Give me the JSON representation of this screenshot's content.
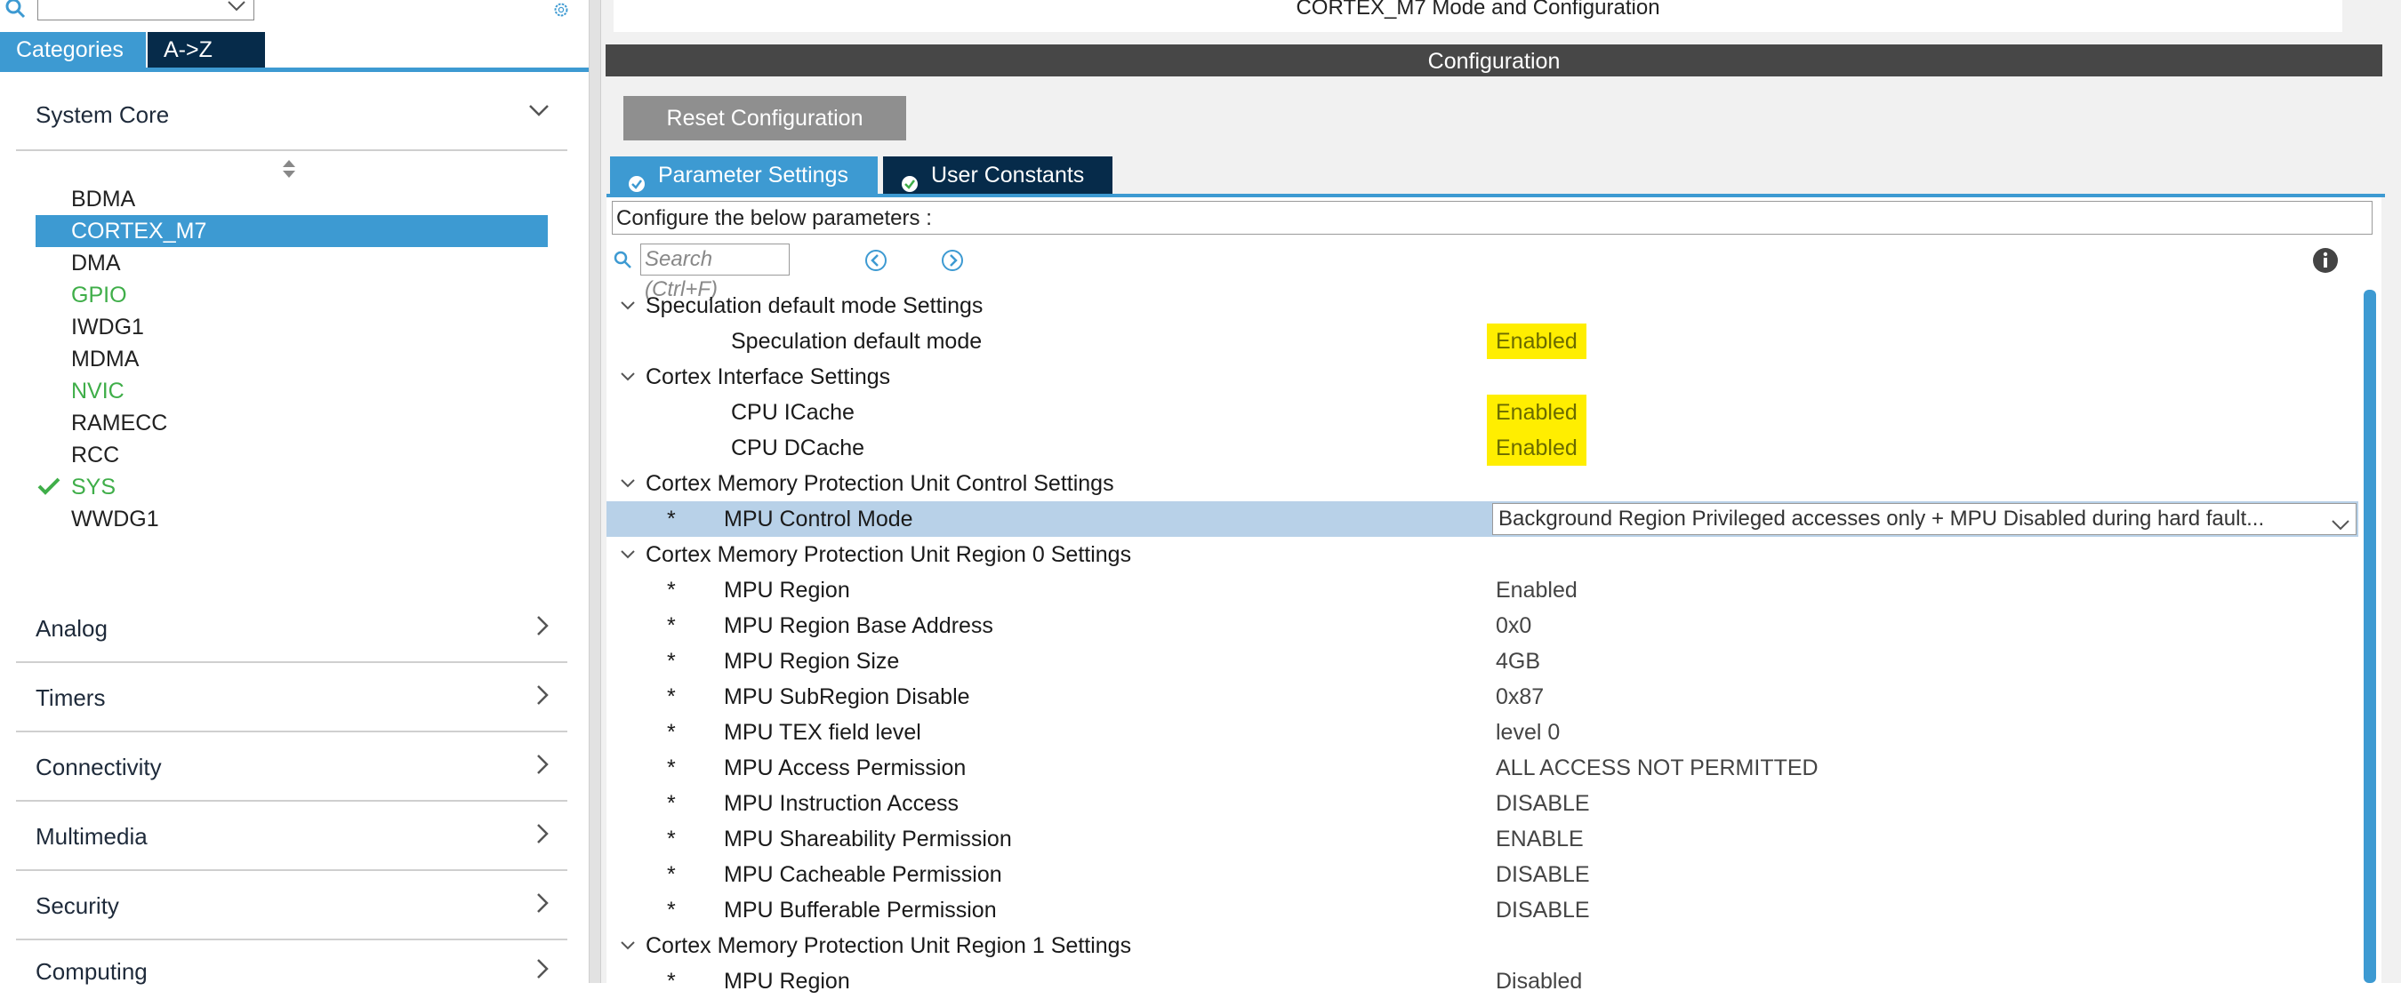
{
  "left_panel": {
    "tabs": {
      "categories": "Categories",
      "az": "A->Z"
    },
    "categories": [
      {
        "label": "System Core",
        "expanded": true
      },
      {
        "label": "Analog",
        "expanded": false
      },
      {
        "label": "Timers",
        "expanded": false
      },
      {
        "label": "Connectivity",
        "expanded": false
      },
      {
        "label": "Multimedia",
        "expanded": false
      },
      {
        "label": "Security",
        "expanded": false
      },
      {
        "label": "Computing",
        "expanded": false
      }
    ],
    "system_core_items": [
      "BDMA",
      "CORTEX_M7",
      "DMA",
      "GPIO",
      "IWDG1",
      "MDMA",
      "NVIC",
      "RAMECC",
      "RCC",
      "SYS",
      "WWDG1"
    ],
    "selected_item": "CORTEX_M7"
  },
  "right_panel": {
    "mode_title": "CORTEX_M7 Mode and Configuration",
    "config_title": "Configuration",
    "reset_button": "Reset Configuration",
    "tabs": {
      "param": "Parameter Settings",
      "user": "User Constants"
    },
    "instruction": "Configure the below parameters :",
    "search_placeholder": "Search (Ctrl+F)",
    "groups": [
      {
        "title": "Speculation default mode Settings",
        "params": [
          {
            "label": "Speculation default mode",
            "value": "Enabled",
            "highlight": true
          }
        ]
      },
      {
        "title": "Cortex Interface Settings",
        "params": [
          {
            "label": "CPU ICache",
            "value": "Enabled",
            "highlight": true
          },
          {
            "label": "CPU DCache",
            "value": "Enabled",
            "highlight": true
          }
        ]
      },
      {
        "title": "Cortex Memory Protection Unit Control Settings",
        "params": [
          {
            "label": "MPU Control Mode",
            "value": "Background Region Privileged accesses only + MPU Disabled during hard fault...",
            "selected": true
          }
        ]
      },
      {
        "title": "Cortex Memory Protection Unit Region 0 Settings",
        "params": [
          {
            "label": "MPU Region",
            "value": "Enabled"
          },
          {
            "label": "MPU Region Base Address",
            "value": "0x0"
          },
          {
            "label": "MPU Region Size",
            "value": "4GB"
          },
          {
            "label": "MPU SubRegion Disable",
            "value": "0x87"
          },
          {
            "label": "MPU TEX field level",
            "value": "level 0"
          },
          {
            "label": "MPU Access Permission",
            "value": "ALL ACCESS NOT PERMITTED"
          },
          {
            "label": "MPU Instruction Access",
            "value": "DISABLE"
          },
          {
            "label": "MPU Shareability Permission",
            "value": "ENABLE"
          },
          {
            "label": "MPU Cacheable Permission",
            "value": "DISABLE"
          },
          {
            "label": "MPU Bufferable  Permission",
            "value": "DISABLE"
          }
        ]
      },
      {
        "title": "Cortex Memory Protection Unit Region 1 Settings",
        "params": [
          {
            "label": "MPU Region",
            "value": "Disabled"
          }
        ]
      }
    ],
    "star": "*"
  },
  "colors": {
    "accent": "#3d9ad2",
    "dark_tab": "#062b4a",
    "highlight": "#ffee00",
    "enabled_green": "#3fae49"
  }
}
